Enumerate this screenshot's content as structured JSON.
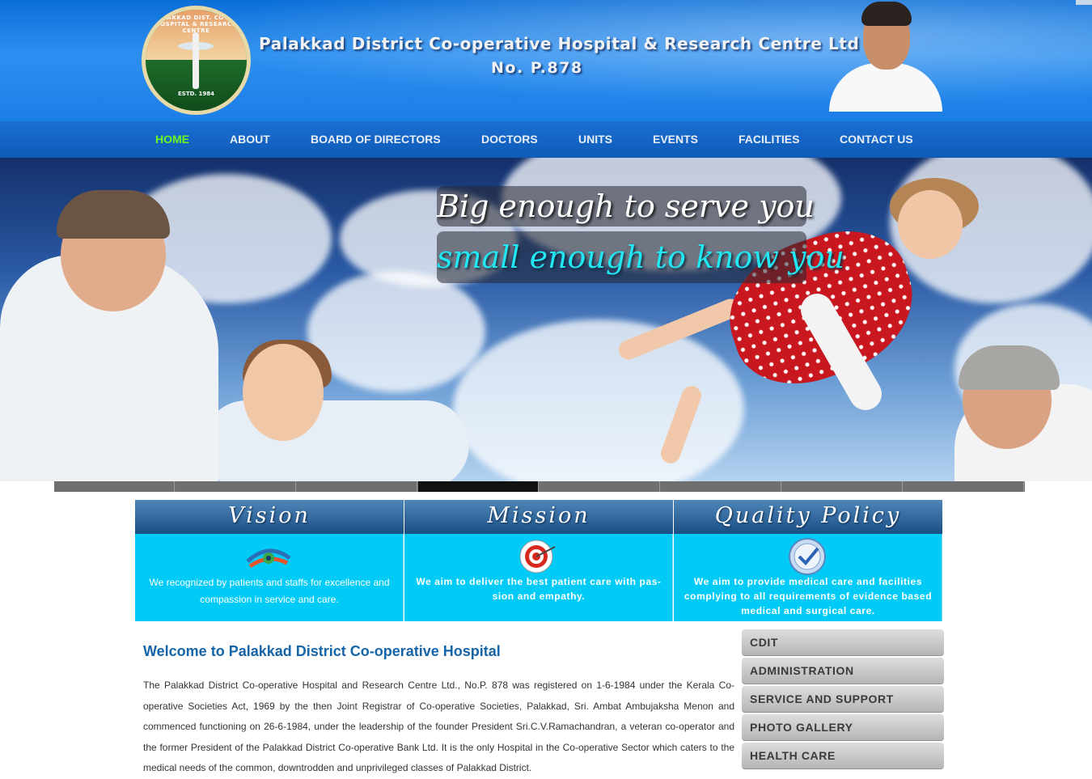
{
  "header": {
    "title": "Palakkad District Co-operative Hospital & Research Centre Ltd",
    "reg_no": "No. P.878",
    "logo_ring_text": "PALAKKAD DIST. CO-OP. HOSPITAL & RESEARCH CENTRE",
    "logo_estd": "ESTD. 1984"
  },
  "nav": {
    "items": [
      {
        "label": "HOME",
        "active": true
      },
      {
        "label": "ABOUT"
      },
      {
        "label": "BOARD OF DIRECTORS"
      },
      {
        "label": "DOCTORS"
      },
      {
        "label": "UNITS"
      },
      {
        "label": "EVENTS"
      },
      {
        "label": "FACILITIES"
      },
      {
        "label": "CONTACT US"
      }
    ]
  },
  "banner": {
    "tagline_1": "Big enough to serve you",
    "tagline_2": "small enough to know you",
    "slides_total": 8,
    "active_slide": 4
  },
  "boxes": [
    {
      "title": "Vision",
      "icon": "eye-icon",
      "text": "We recognized by patients and staffs for excellence and compassion in service and care."
    },
    {
      "title": "Mission",
      "icon": "target-icon",
      "text": "We aim to deliver the best patient care with pas-sion and empathy."
    },
    {
      "title": "Quality Policy",
      "icon": "quality-seal-icon",
      "text": "We  aim to provide  medical care and facilities complying to all requirements of evidence based medical and surgical care."
    }
  ],
  "main": {
    "welcome_title": "Welcome to Palakkad District Co-operative Hospital",
    "paragraph": "The Palakkad District Co-operative Hospital and Research Centre Ltd., No.P. 878 was registered on 1-6-1984 under the Kerala Co-operative Societies Act, 1969 by the then Joint Registrar of Co-operative Societies, Palakkad, Sri. Ambat Ambujaksha Menon and commenced functioning on 26-6-1984, under the leadership of the founder President Sri.C.V.Ramachandran, a veteran co-operator and the former President of the Palakkad District Co-operative Bank Ltd. It is the only Hospital in the Co-operative Sector which caters to the medical needs of the common, downtrodden and unprivileged classes of Palakkad District."
  },
  "side_menu": {
    "items": [
      "CDIT",
      "ADMINISTRATION",
      "SERVICE AND SUPPORT",
      "PHOTO GALLERY",
      "HEALTH CARE"
    ]
  },
  "colors": {
    "header_blue": "#1a7ee6",
    "nav_blue": "#0f5bb8",
    "nav_active": "#6cf71f",
    "box_cyan": "#00cbf7",
    "welcome_title": "#1565a8",
    "tagline_cyan": "#22e6f2"
  }
}
